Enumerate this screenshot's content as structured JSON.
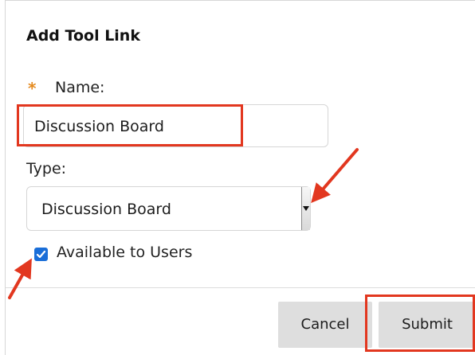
{
  "dialog": {
    "title": "Add Tool Link",
    "required_marker": "*",
    "name": {
      "label": "Name:",
      "value": "Discussion Board"
    },
    "type": {
      "label": "Type:",
      "selected": "Discussion Board"
    },
    "available": {
      "label": "Available to Users",
      "checked": true
    },
    "buttons": {
      "cancel": "Cancel",
      "submit": "Submit"
    }
  },
  "colors": {
    "required_star": "#e48a1e",
    "checkbox": "#1a6ed8",
    "annotation": "#e2371f",
    "button_bg": "#dedede"
  },
  "icons": {
    "select_arrow": "caret-down-icon",
    "checkbox": "checkmark-icon",
    "annotations": "red-arrow-icon"
  }
}
